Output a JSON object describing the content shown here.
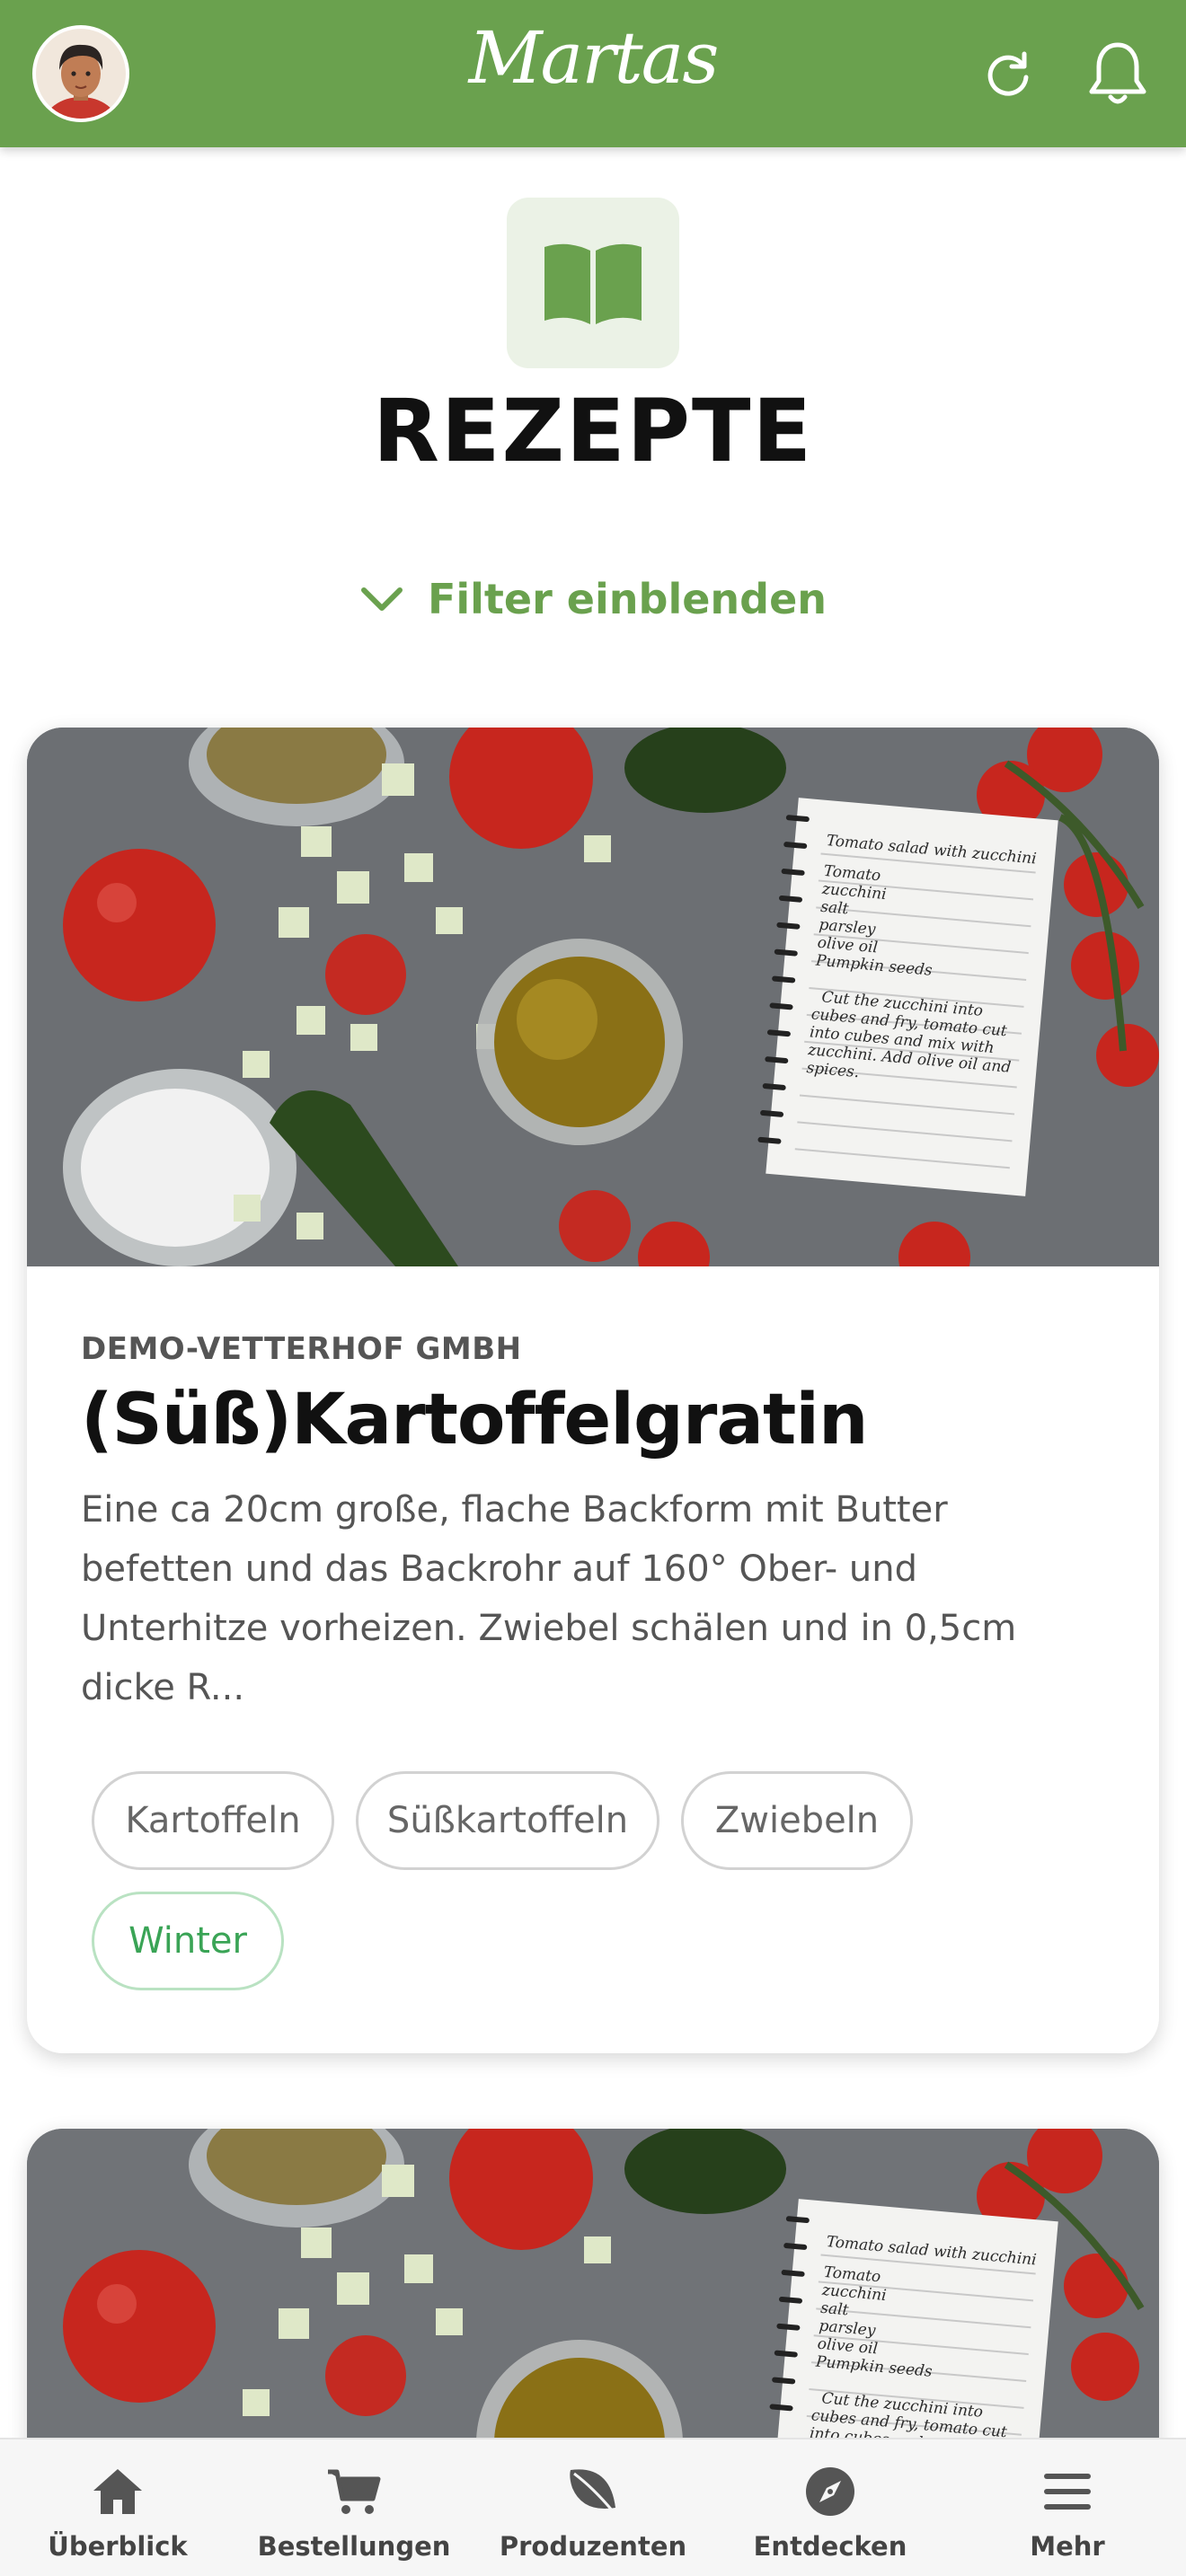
{
  "header": {
    "logo_text": "Martas",
    "avatar_icon": "user-avatar",
    "refresh_icon": "refresh-icon",
    "bell_icon": "bell-icon",
    "brand_color": "#6aa14e"
  },
  "page": {
    "title": "REZEPTE",
    "title_icon": "book-icon",
    "filter_label": "Filter einblenden",
    "filter_icon": "chevron-down-icon"
  },
  "recipes": [
    {
      "producer": "DEMO-VETTERHOF GMBH",
      "title": "(Süß)Kartoffelgratin",
      "description": "Eine ca 20cm große, flache Backform mit Butter befetten und das Backrohr auf 160° Ober- und Unterhitze vorheizen. Zwiebel schälen und in 0,5cm dicke R...",
      "tags": [
        "Kartoffeln",
        "Süßkartoffeln",
        "Zwiebeln",
        "Winter"
      ],
      "highlighted_tag": "Winter",
      "image_notebook_lines": [
        "Tomato salad with zucchini",
        "Tomato",
        "zucchini",
        "salt",
        "parsley",
        "olive oil",
        "Pumpkin seeds",
        "Cut the zucchini into",
        "cubes and fry, tomato cut",
        "into cubes and mix with",
        "zucchini. Add olive oil and",
        "spices."
      ]
    },
    {
      "image_notebook_lines": [
        "Tomato salad with zucchini",
        "Tomato",
        "zucchini",
        "salt",
        "parsley",
        "olive oil",
        "Pumpkin seeds",
        "Cut the zucchini into",
        "cubes and fry, tomato cut",
        "into cubes and mix with"
      ]
    }
  ],
  "bottom_nav": [
    {
      "label": "Überblick",
      "icon": "home-icon"
    },
    {
      "label": "Bestellungen",
      "icon": "cart-icon"
    },
    {
      "label": "Produzenten",
      "icon": "leaf-icon"
    },
    {
      "label": "Entdecken",
      "icon": "compass-icon"
    },
    {
      "label": "Mehr",
      "icon": "menu-icon"
    }
  ]
}
